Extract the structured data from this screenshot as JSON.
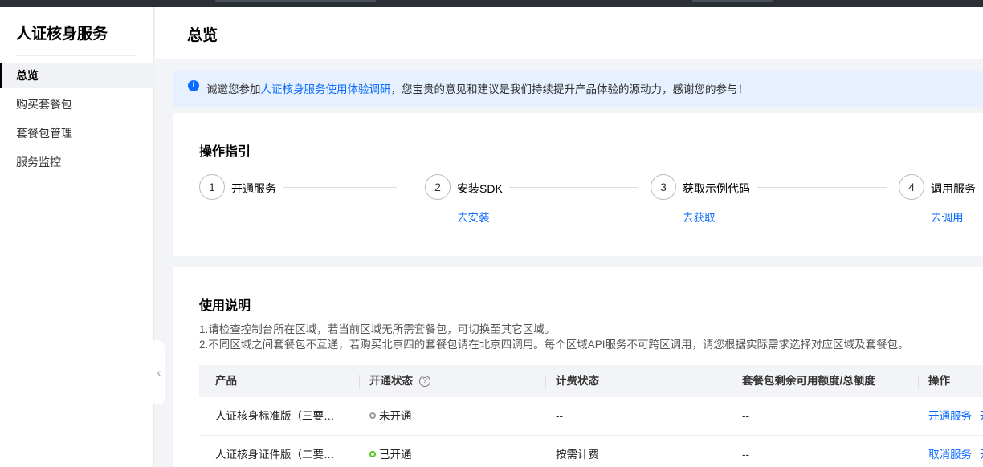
{
  "app": {
    "title": "人证核身服务"
  },
  "sidebar": {
    "items": [
      {
        "label": "总览"
      },
      {
        "label": "购买套餐包"
      },
      {
        "label": "套餐包管理"
      },
      {
        "label": "服务监控"
      }
    ],
    "collapse_glyph": "‹"
  },
  "header": {
    "page_title": "总览"
  },
  "notice": {
    "prefix": "诚邀您参加",
    "link": "人证核身服务使用体验调研",
    "suffix": "，您宝贵的意见和建议是我们持续提升产品体验的源动力，感谢您的参与！",
    "icon": "info-icon"
  },
  "guide": {
    "title": "操作指引",
    "steps": [
      {
        "num": "1",
        "label": "开通服务",
        "link": ""
      },
      {
        "num": "2",
        "label": "安装SDK",
        "link": "去安装"
      },
      {
        "num": "3",
        "label": "获取示例代码",
        "link": "去获取"
      },
      {
        "num": "4",
        "label": "调用服务",
        "link": "去调用"
      }
    ]
  },
  "usage": {
    "title": "使用说明",
    "lines": [
      "1.请检查控制台所在区域，若当前区域无所需套餐包，可切换至其它区域。",
      "2.不同区域之间套餐包不互通，若购买北京四的套餐包请在北京四调用。每个区域API服务不可跨区调用，请您根据实际需求选择对应区域及套餐包。"
    ],
    "table": {
      "headers": [
        "产品",
        "开通状态",
        "计费状态",
        "套餐包剩余可用额度/总额度",
        "操作"
      ],
      "rows": [
        {
          "product": "人证核身标准版（三要…",
          "status": "未开通",
          "status_color": "#999999",
          "billing": "--",
          "quota": "--",
          "action": "开通服务",
          "action2": "开"
        },
        {
          "product": "人证核身证件版（二要…",
          "status": "已开通",
          "status_color": "#52c41a",
          "billing": "按需计费",
          "quota": "--",
          "action": "取消服务",
          "action2": "开"
        }
      ]
    }
  },
  "colors": {
    "accent": "#0a6cff",
    "notice_bg": "#e6f0ff"
  }
}
